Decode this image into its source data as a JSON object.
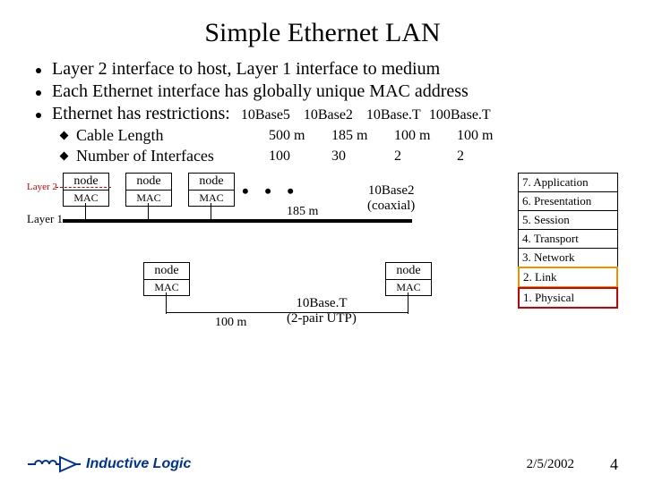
{
  "title": "Simple Ethernet LAN",
  "bullets": [
    "Layer 2 interface to host, Layer 1 interface to medium",
    "Each Ethernet interface has globally unique MAC address",
    "Ethernet has restrictions:"
  ],
  "table": {
    "cols": [
      "10Base5",
      "10Base2",
      "10Base.T",
      "100Base.T"
    ],
    "rows": [
      {
        "label": "Cable Length",
        "vals": [
          "500 m",
          "185 m",
          "100 m",
          "100 m"
        ]
      },
      {
        "label": "Number of Interfaces",
        "vals": [
          "100",
          "30",
          "2",
          "2"
        ]
      }
    ]
  },
  "diagram": {
    "node_label": "node",
    "mac_label": "MAC",
    "layer2": "Layer 2",
    "layer1": "Layer 1",
    "dots": "• • •",
    "cable_top": {
      "name": "10Base2",
      "sub": "(coaxial)",
      "len": "185 m"
    },
    "cable_bot": {
      "name": "10Base.T",
      "sub": "(2-pair UTP)",
      "len": "100 m"
    }
  },
  "osi": [
    "7. Application",
    "6. Presentation",
    "5. Session",
    "4. Transport",
    "3. Network",
    "2. Link",
    "1. Physical"
  ],
  "footer": {
    "brand": "Inductive Logic",
    "date": "2/5/2002",
    "page": "4"
  },
  "chart_data": {
    "type": "table",
    "title": "Ethernet restrictions",
    "columns": [
      "",
      "10Base5",
      "10Base2",
      "10Base.T",
      "100Base.T"
    ],
    "rows": [
      [
        "Cable Length",
        "500 m",
        "185 m",
        "100 m",
        "100 m"
      ],
      [
        "Number of Interfaces",
        100,
        30,
        2,
        2
      ]
    ]
  }
}
